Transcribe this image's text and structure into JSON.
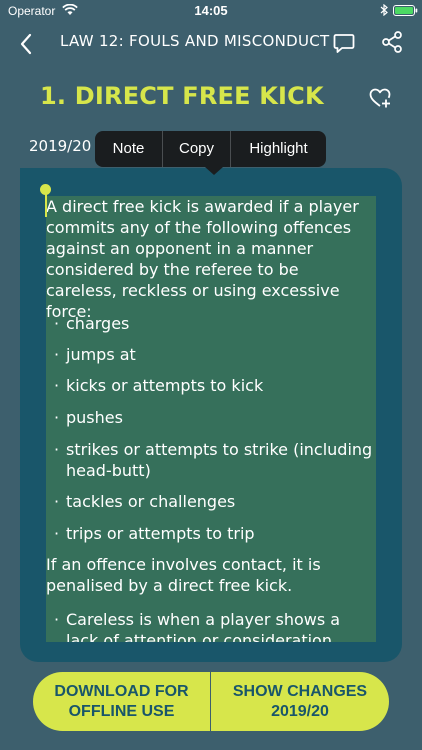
{
  "status_bar": {
    "carrier": "Operator",
    "time": "14:05"
  },
  "nav": {
    "title": "LAW 12: FOULS AND MISCONDUCT"
  },
  "section": {
    "title": "1. DIRECT FREE KICK",
    "season": "2019/20"
  },
  "context_menu": {
    "note": "Note",
    "copy": "Copy",
    "highlight": "Highlight"
  },
  "content": {
    "intro": "A direct free kick is awarded if a player commits any of the following offences against an opponent in a manner considered by the referee to be careless, reckless or using excessive force:",
    "bullets": [
      "charges",
      "jumps at",
      "kicks or attempts to kick",
      "pushes",
      "strikes or attempts to strike (including head-butt)",
      "tackles or challenges",
      "trips or attempts to trip"
    ],
    "contact": "If an offence involves contact, it is penalised by a direct free kick.",
    "careless": "Careless is when a player shows a lack of attention or consideration when making",
    "bullet_symbol": "·"
  },
  "footer": {
    "download_label": "DOWNLOAD FOR OFFLINE USE",
    "changes_label": "SHOW CHANGES 2019/20"
  },
  "colors": {
    "background": "#3d5f6d",
    "accent": "#d7e64b",
    "card": "#19566a",
    "selection": "#36705b",
    "menu": "#1a1d1f"
  }
}
